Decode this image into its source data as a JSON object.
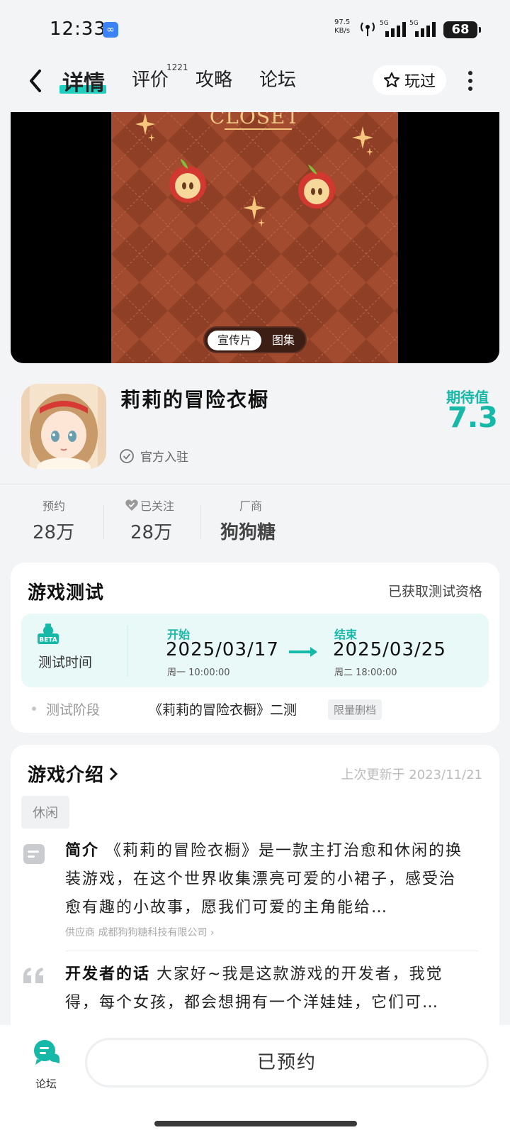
{
  "status_bar": {
    "time": "12:33",
    "net_speed_value": "97.5",
    "net_speed_unit": "KB/s",
    "sim1": "5G",
    "sim2": "5G",
    "battery": "68"
  },
  "header": {
    "tabs": [
      {
        "label": "详情",
        "active": true
      },
      {
        "label": "评价",
        "count": "1221"
      },
      {
        "label": "攻略"
      },
      {
        "label": "论坛"
      }
    ],
    "played_label": "玩过"
  },
  "hero": {
    "art_title": "CLOSET",
    "toggle": [
      "宣传片",
      "图集"
    ]
  },
  "game": {
    "title": "莉莉的冒险衣橱",
    "official_label": "官方入驻",
    "expect_label": "期待值",
    "expect_value": "7.3"
  },
  "stats": [
    {
      "label": "预约",
      "value": "28万"
    },
    {
      "label": "已关注",
      "value": "28万"
    },
    {
      "label": "厂商",
      "value": "狗狗糖"
    }
  ],
  "test": {
    "title": "游戏测试",
    "qualification": "已获取测试资格",
    "time_label": "测试时间",
    "beta_badge": "BETA",
    "start_label": "开始",
    "start_date": "2025/03/17",
    "start_time": "周一  10:00:00",
    "end_label": "结束",
    "end_date": "2025/03/25",
    "end_time": "周二  18:00:00",
    "stage_label": "测试阶段",
    "stage_value": "《莉莉的冒险衣橱》二测",
    "stage_tag": "限量删档"
  },
  "intro": {
    "title": "游戏介绍",
    "updated": "上次更新于 2023/11/21",
    "tag": "休闲",
    "summary_label": "简介",
    "summary_text": "《莉莉的冒险衣橱》是一款主打治愈和休闲的换装游戏，在这个世界收集漂亮可爱的小裙子，感受治愈有趣的小故事，愿我们可爱的主角能给…",
    "supplier": "供应商 成都狗狗糖科技有限公司 ›",
    "dev_label": "开发者的话",
    "dev_text": "大家好~我是这款游戏的开发者，我觉得，每个女孩，都会想拥有一个洋娃娃，它们可…"
  },
  "bottom": {
    "forum_label": "论坛",
    "reserve_label": "已预约"
  },
  "colors": {
    "accent": "#16b8a8",
    "hero_bg": "#a14a2d"
  }
}
